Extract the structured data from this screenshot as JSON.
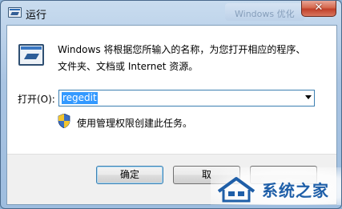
{
  "window": {
    "title": "运行",
    "close_glyph": "✕",
    "background_window_title": "Windows 优化"
  },
  "content": {
    "description_line1": "Windows 将根据您所输入的名称，为您打开相应的程序、",
    "description_line2": "文件夹、文档或 Internet 资源。",
    "open_label": "打开(O):",
    "input_value": "regedit",
    "admin_note": "使用管理权限创建此任务。"
  },
  "buttons": {
    "ok": "确定",
    "cancel": "取",
    "browse": ""
  },
  "watermark": {
    "text": "系统之家"
  },
  "icons": [
    "run-app-icon",
    "run-program-icon",
    "uac-shield-icon",
    "dropdown-arrow-icon",
    "close-icon",
    "watermark-logo-icon"
  ],
  "colors": {
    "titlebar": "#a9c4e2",
    "close_button": "#c0402a",
    "selection": "#3399ff",
    "focus_border": "#3c7fb1"
  }
}
